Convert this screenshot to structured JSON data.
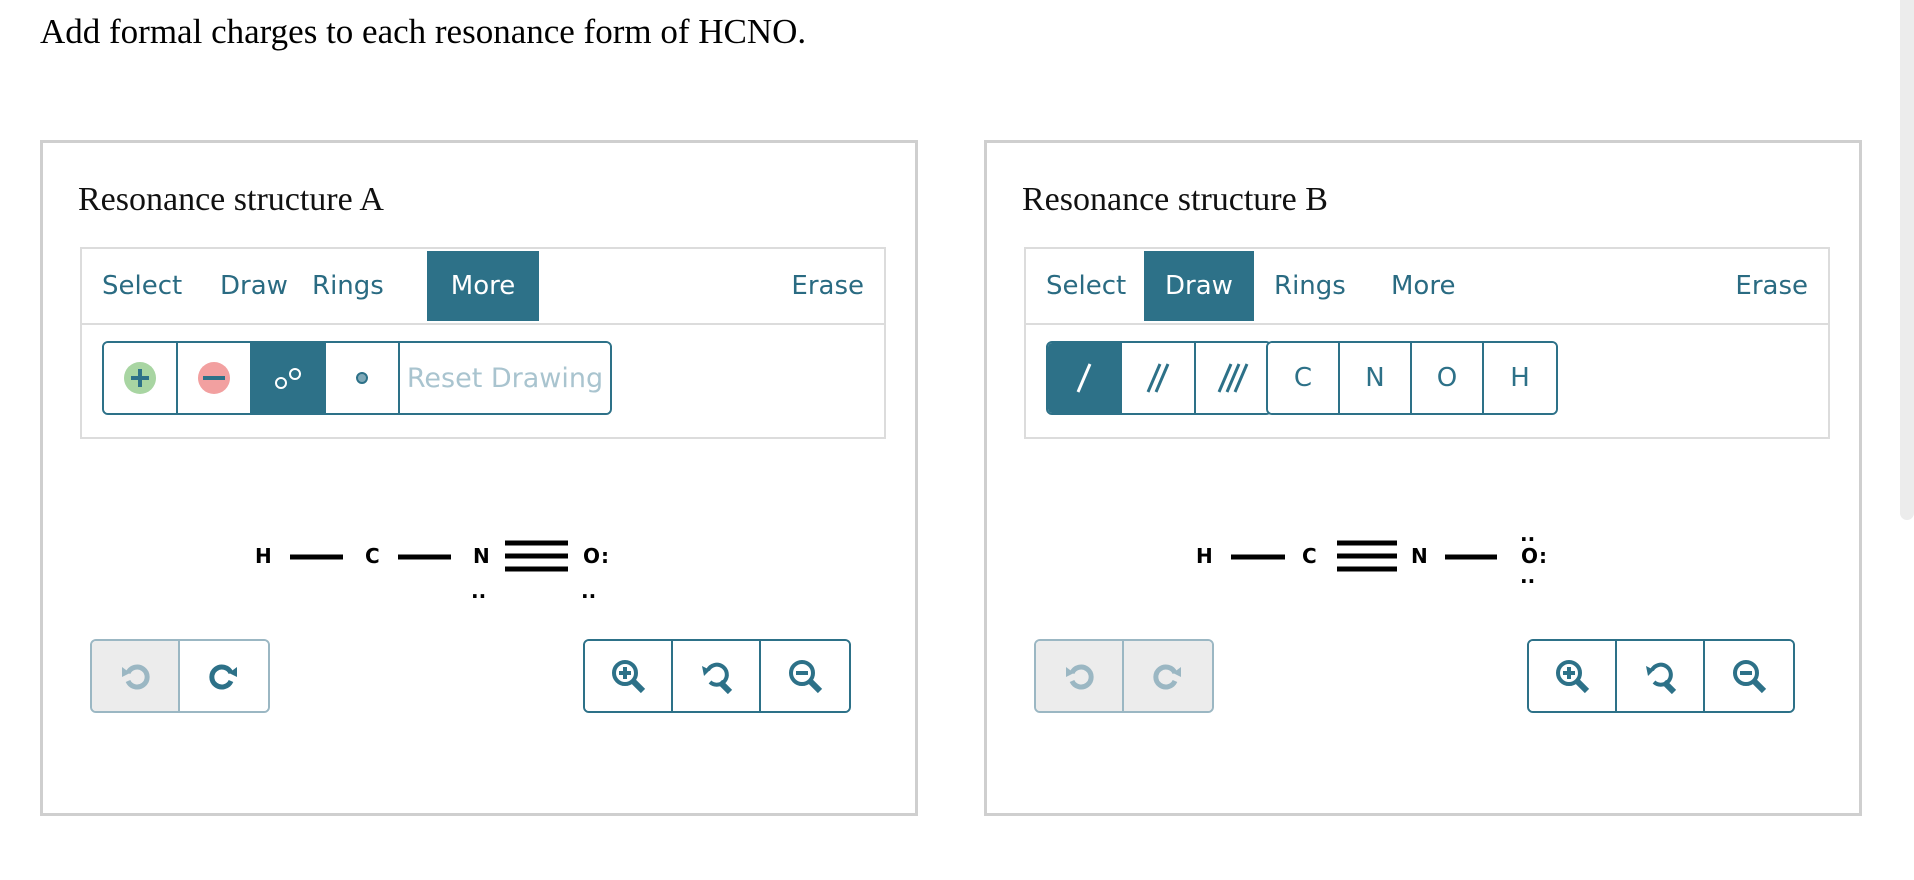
{
  "question": "Add formal charges to each resonance form of HCNO.",
  "colors": {
    "accent": "#2d7188",
    "panel_border": "#cfcfcf",
    "plus": "#a8d5a2",
    "minus": "#f2a0a0"
  },
  "panels": [
    {
      "title": "Resonance structure A",
      "tabs": [
        "Select",
        "Draw",
        "Rings",
        "More"
      ],
      "erase": "Erase",
      "active_tab": "More",
      "tools": [
        "plus-charge-icon",
        "minus-charge-icon",
        "lone-pair-icon",
        "radical-icon"
      ],
      "reset_label": "Reset Drawing",
      "atoms": [
        "H",
        "C",
        "N",
        "O"
      ],
      "lone_pairs": {
        "N": "..",
        "O_right": ":",
        "O_bottom": ".."
      }
    },
    {
      "title": "Resonance structure B",
      "tabs": [
        "Select",
        "Draw",
        "Rings",
        "More"
      ],
      "erase": "Erase",
      "active_tab": "Draw",
      "bonds": [
        "single-bond-icon",
        "double-bond-icon",
        "triple-bond-icon"
      ],
      "atom_buttons": [
        "C",
        "N",
        "O",
        "H"
      ],
      "atoms": [
        "H",
        "C",
        "N",
        "O"
      ],
      "lone_pairs": {
        "O_top": "..",
        "O_right": ":",
        "O_bottom": ".."
      }
    }
  ]
}
